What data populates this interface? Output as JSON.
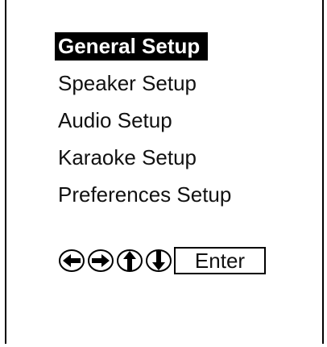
{
  "menu": {
    "items": [
      {
        "label": "General Setup",
        "selected": true
      },
      {
        "label": "Speaker Setup",
        "selected": false
      },
      {
        "label": "Audio Setup",
        "selected": false
      },
      {
        "label": "Karaoke Setup",
        "selected": false
      },
      {
        "label": "Preferences Setup",
        "selected": false
      }
    ]
  },
  "controls": {
    "icons": [
      "left-arrow-icon",
      "right-arrow-icon",
      "up-arrow-icon",
      "down-arrow-icon"
    ],
    "enter_label": "Enter"
  }
}
